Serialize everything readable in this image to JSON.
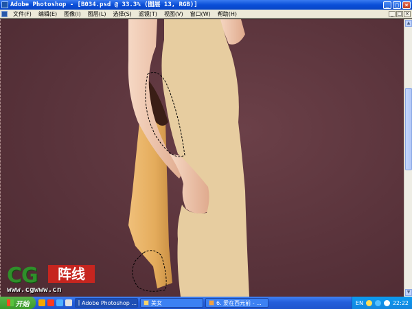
{
  "window": {
    "title": "Adobe Photoshop - [B034.psd @ 33.3% (图层 13, RGB)]",
    "controls": [
      "_",
      "□",
      "×"
    ]
  },
  "menubar": {
    "items": [
      "文件(F)",
      "编辑(E)",
      "图像(I)",
      "图层(L)",
      "选择(S)",
      "滤镜(T)",
      "视图(V)",
      "窗口(W)",
      "帮助(H)"
    ],
    "controls": [
      "_",
      "□",
      "×"
    ]
  },
  "canvas": {
    "background_color": "#5c343c",
    "fill_color": "#e7cda0",
    "skin_color": "#eec7b0",
    "fabric_color": "#e8b66a"
  },
  "scrollbar": {
    "up": "▲",
    "down": "▼"
  },
  "watermark": {
    "letters": "CG",
    "chinese": "阵线",
    "url": "www.cgwww.cn"
  },
  "taskbar": {
    "start_label": "开始",
    "tasks": [
      {
        "label": "Adobe Photoshop ...",
        "active": true
      },
      {
        "label": "美女",
        "active": false
      },
      {
        "label": "6. 爱在西元前 - ...",
        "active": false
      }
    ],
    "language": "EN",
    "clock": "22:22"
  }
}
